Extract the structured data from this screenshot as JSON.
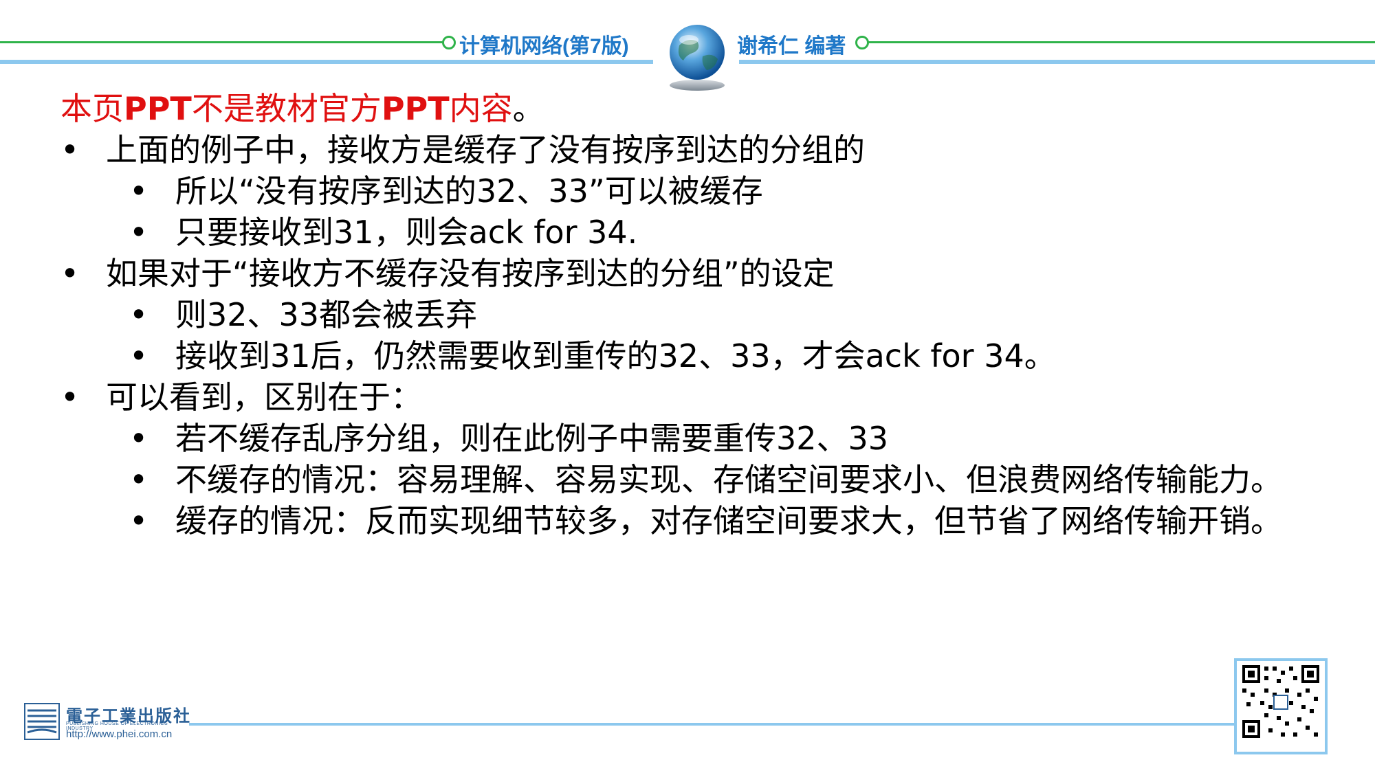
{
  "header": {
    "book_title": "计算机网络(第7版)",
    "author": "谢希仁 编著"
  },
  "content": {
    "note": {
      "parts": [
        "本页",
        "PPT",
        "不是教材官方",
        "PPT",
        "内容",
        "。"
      ]
    },
    "sections": [
      {
        "text": "上面的例子中，接收方是缓存了没有按序到达的分组的",
        "subs": [
          "所以“没有按序到达的32、33”可以被缓存",
          "只要接收到31，则会ack for 34."
        ]
      },
      {
        "text": "如果对于“接收方不缓存没有按序到达的分组”的设定",
        "subs": [
          "则32、33都会被丢弃",
          "接收到31后，仍然需要收到重传的32、33，才会ack for 34。"
        ]
      },
      {
        "text": "可以看到，区别在于：",
        "subs": [
          "若不缓存乱序分组，则在此例子中需要重传32、33",
          "不缓存的情况：容易理解、容易实现、存储空间要求小、但浪费网络传输能力。",
          "缓存的情况：反而实现细节较多，对存储空间要求大，但节省了网络传输开销。"
        ]
      }
    ],
    "bullet": "•"
  },
  "footer": {
    "publisher_name": "電子工業出版社",
    "publisher_sub": "PUBLISHING HOUSE OF ELECTRONICS INDUSTRY",
    "publisher_url": "http://www.phei.com.cn"
  },
  "colors": {
    "accent_green": "#2fb34a",
    "accent_blue": "#8cc8ee",
    "title_blue": "#1f78c8",
    "note_red": "#e01010"
  }
}
